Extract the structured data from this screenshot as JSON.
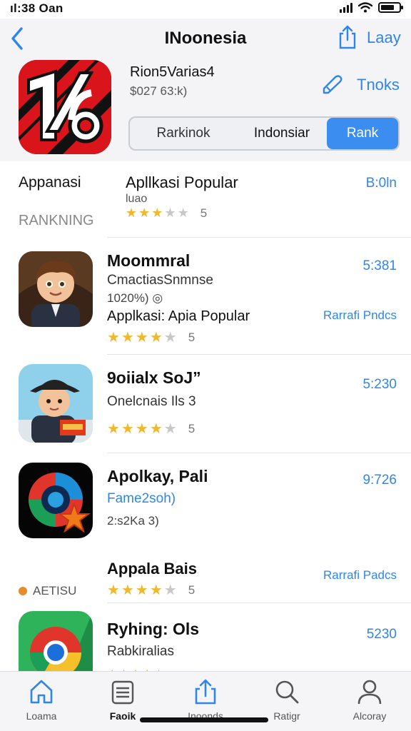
{
  "status_bar": {
    "time": "ıl:38 Oan"
  },
  "header": {
    "title": "INoonesia",
    "right_label": "Laay",
    "app_name": "Rion5Varias4",
    "app_sub": "$027 63:k)",
    "secondary_action": "Tnoks"
  },
  "segmented": {
    "options": [
      "Rarkinok",
      "Indonsiar",
      "Rank"
    ],
    "selected": "Rank"
  },
  "section": {
    "left_top": "Appanasi",
    "left_bottom": "RANKNING",
    "title": "Apllkasi Popular",
    "subtitle": "luao",
    "rating_count": "5",
    "price": "B:0ln"
  },
  "apps": [
    {
      "name": "Moommral",
      "developer": "CmactiasSnmnse",
      "meta": "1020%) ◎",
      "category": "Applkasi: Apia Popular",
      "rank_label": "Rarrafi Pndcs",
      "price": "5:381",
      "rating_count": "5"
    },
    {
      "name": "9oiialx SoJ”",
      "developer": "Onelcnais Ils 3",
      "rating_count": "5",
      "price": "5:230"
    },
    {
      "name": "Apolkay, Pali",
      "developer": "Fame2soh)",
      "meta": "2:s2Ka 3)",
      "category": "Appala Bais",
      "badge": "AETISU",
      "rank_label": "Rarrafi Padcs",
      "price": "9:726",
      "rating_count": "5"
    },
    {
      "name": "Ryhing: Ols",
      "developer": "Rabkiralias",
      "price": "5230"
    }
  ],
  "tabbar": {
    "tabs": [
      "Loama",
      "Faoik",
      "Inoonds",
      "Ratigr",
      "Alcoray"
    ]
  },
  "colors": {
    "accent": "#2f86e8",
    "star": "#f2b82a",
    "segment_selected": "#3b8ef0"
  },
  "icons": [
    "back-chevron-icon",
    "share-icon",
    "pencil-icon",
    "home-icon",
    "list-icon",
    "upload-icon",
    "search-icon",
    "person-icon"
  ]
}
